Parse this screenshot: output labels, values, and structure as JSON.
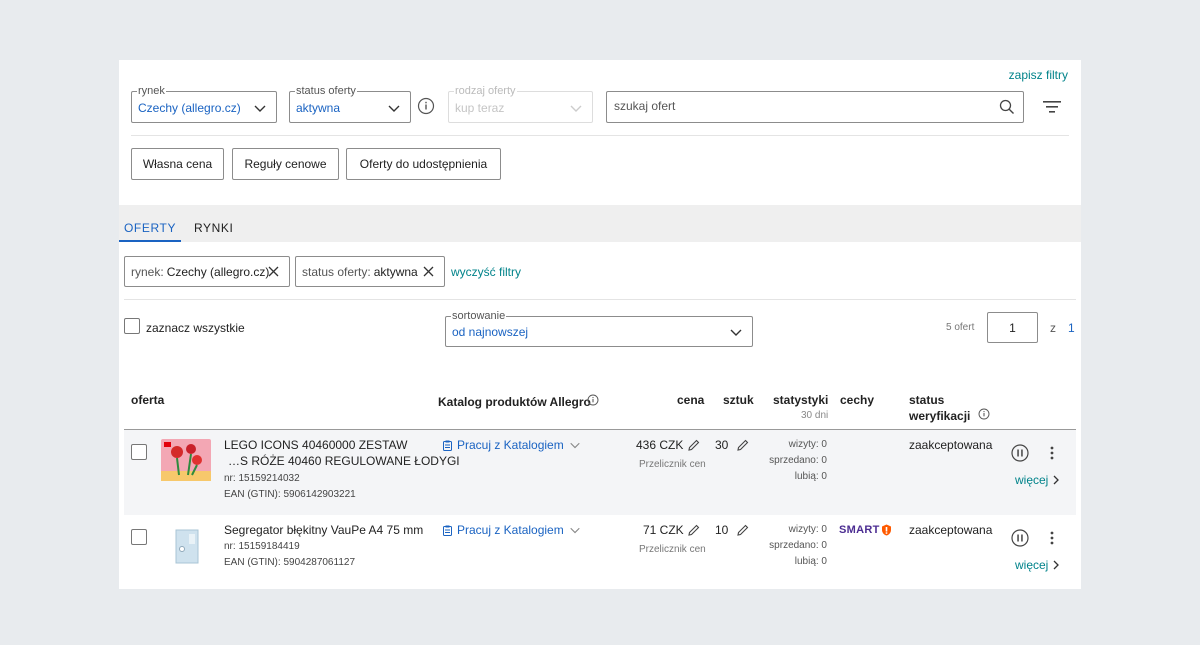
{
  "filters": {
    "save_filters": "zapisz filtry",
    "market": {
      "legend": "rynek",
      "value": "Czechy (allegro.cz)"
    },
    "offer_status": {
      "legend": "status oferty",
      "value": "aktywna"
    },
    "offer_type": {
      "legend": "rodzaj oferty",
      "value": "kup teraz"
    },
    "search_placeholder": "szukaj ofert",
    "buttons": [
      "Własna cena",
      "Reguły cenowe",
      "Oferty do udostępnienia"
    ]
  },
  "tabs": [
    "OFERTY",
    "RYNKI"
  ],
  "active_filters": {
    "chips": [
      {
        "key": "rynek:",
        "value": "Czechy (allegro.cz)"
      },
      {
        "key": "status oferty:",
        "value": "aktywna"
      }
    ],
    "clear": "wyczyść filtry"
  },
  "list_controls": {
    "select_all": "zaznacz wszystkie",
    "sort_legend": "sortowanie",
    "sort_value": "od najnowszej",
    "offers_count": "5 ofert",
    "page": "1",
    "of": "z",
    "total_pages": "1"
  },
  "table": {
    "headers": {
      "offer": "oferta",
      "catalog": "Katalog produktów Allegro",
      "price": "cena",
      "quantity": "sztuk",
      "stats": "statystyki",
      "stats_sub": "30 dni",
      "features": "cechy",
      "status_line1": "status",
      "status_line2": "weryfikacji"
    },
    "rows": [
      {
        "title_line1": "LEGO ICONS 40460000 ZESTAW",
        "title_line2": "…S RÓŻE 40460 REGULOWANE ŁODYGI",
        "nr": "nr: 15159214032",
        "ean": "EAN (GTIN): 5906142903221",
        "catalog": "Pracuj z Katalogiem",
        "price": "436 CZK",
        "price_sub": "Przelicznik cen",
        "quantity": "30",
        "visits": "wizyty: 0",
        "sold": "sprzedano: 0",
        "likes": "lubią: 0",
        "feature": "",
        "status": "zaakceptowana",
        "more": "więcej"
      },
      {
        "title_line1": "Segregator błękitny VauPe A4 75 mm",
        "title_line2": "",
        "nr": "nr: 15159184419",
        "ean": "EAN (GTIN): 5904287061127",
        "catalog": "Pracuj z Katalogiem",
        "price": "71 CZK",
        "price_sub": "Przelicznik cen",
        "quantity": "10",
        "visits": "wizyty: 0",
        "sold": "sprzedano: 0",
        "likes": "lubią: 0",
        "feature": "SMART",
        "status": "zaakceptowana",
        "more": "więcej"
      }
    ]
  }
}
